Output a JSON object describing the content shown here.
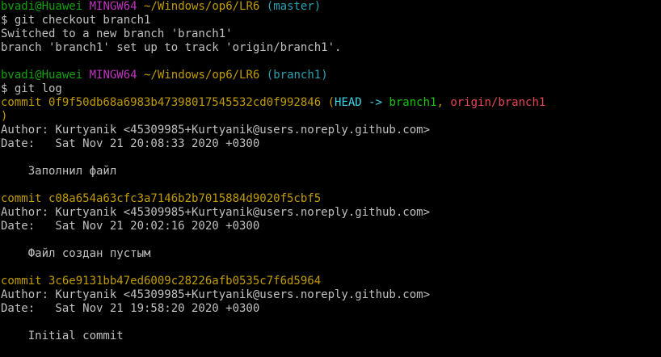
{
  "colors": {
    "background": "#000000",
    "default_text": "#c0c0c0",
    "user_host": "#13a10e",
    "mingw": "#c034c0",
    "path": "#c19c00",
    "branch_paren": "#2aa1b3",
    "head": "#3bd6e6",
    "local_branch": "#16c60c",
    "remote_branch": "#e74856"
  },
  "terminal": {
    "lines": [
      {
        "segments": [
          {
            "text": "bvadi@Huawei",
            "color": "green"
          },
          {
            "text": " ",
            "color": "gray"
          },
          {
            "text": "MINGW64",
            "color": "magenta"
          },
          {
            "text": " ",
            "color": "gray"
          },
          {
            "text": "~/Windows/op6/LR6",
            "color": "yellow"
          },
          {
            "text": " ",
            "color": "gray"
          },
          {
            "text": "(master)",
            "color": "cyan"
          }
        ]
      },
      {
        "segments": [
          {
            "text": "$ git checkout branch1",
            "color": "gray"
          }
        ]
      },
      {
        "segments": [
          {
            "text": "Switched to a new branch 'branch1'",
            "color": "gray"
          }
        ]
      },
      {
        "segments": [
          {
            "text": "branch 'branch1' set up to track 'origin/branch1'.",
            "color": "gray"
          }
        ]
      },
      {
        "segments": [
          {
            "text": "",
            "color": "gray"
          }
        ]
      },
      {
        "segments": [
          {
            "text": "bvadi@Huawei",
            "color": "green"
          },
          {
            "text": " ",
            "color": "gray"
          },
          {
            "text": "MINGW64",
            "color": "magenta"
          },
          {
            "text": " ",
            "color": "gray"
          },
          {
            "text": "~/Windows/op6/LR6",
            "color": "yellow"
          },
          {
            "text": " ",
            "color": "gray"
          },
          {
            "text": "(branch1)",
            "color": "cyan"
          }
        ]
      },
      {
        "segments": [
          {
            "text": "$ git log",
            "color": "gray"
          }
        ]
      },
      {
        "segments": [
          {
            "text": "commit 0f9f50db68a6983b47398017545532cd0f992846 ",
            "color": "yellow"
          },
          {
            "text": "(",
            "color": "yellow"
          },
          {
            "text": "HEAD -> ",
            "color": "bcyan"
          },
          {
            "text": "branch1",
            "color": "bgreen"
          },
          {
            "text": ", ",
            "color": "yellow"
          },
          {
            "text": "origin/branch1",
            "color": "bred"
          }
        ]
      },
      {
        "segments": [
          {
            "text": ")",
            "color": "yellow"
          }
        ]
      },
      {
        "segments": [
          {
            "text": "Author: Kurtyanik <45309985+Kurtyanik@users.noreply.github.com>",
            "color": "gray"
          }
        ]
      },
      {
        "segments": [
          {
            "text": "Date:   Sat Nov 21 20:08:33 2020 +0300",
            "color": "gray"
          }
        ]
      },
      {
        "segments": [
          {
            "text": "",
            "color": "gray"
          }
        ]
      },
      {
        "segments": [
          {
            "text": "    Заполнил файл",
            "color": "gray"
          }
        ]
      },
      {
        "segments": [
          {
            "text": "",
            "color": "gray"
          }
        ]
      },
      {
        "segments": [
          {
            "text": "commit c08a654a63cfc3a7146b2b7015884d9020f5cbf5",
            "color": "yellow"
          }
        ]
      },
      {
        "segments": [
          {
            "text": "Author: Kurtyanik <45309985+Kurtyanik@users.noreply.github.com>",
            "color": "gray"
          }
        ]
      },
      {
        "segments": [
          {
            "text": "Date:   Sat Nov 21 20:02:16 2020 +0300",
            "color": "gray"
          }
        ]
      },
      {
        "segments": [
          {
            "text": "",
            "color": "gray"
          }
        ]
      },
      {
        "segments": [
          {
            "text": "    Файл создан пустым",
            "color": "gray"
          }
        ]
      },
      {
        "segments": [
          {
            "text": "",
            "color": "gray"
          }
        ]
      },
      {
        "segments": [
          {
            "text": "commit 3c6e9131bb47ed6009c28226afb0535c7f6d5964",
            "color": "yellow"
          }
        ]
      },
      {
        "segments": [
          {
            "text": "Author: Kurtyanik <45309985+Kurtyanik@users.noreply.github.com>",
            "color": "gray"
          }
        ]
      },
      {
        "segments": [
          {
            "text": "Date:   Sat Nov 21 19:58:20 2020 +0300",
            "color": "gray"
          }
        ]
      },
      {
        "segments": [
          {
            "text": "",
            "color": "gray"
          }
        ]
      },
      {
        "segments": [
          {
            "text": "    Initial commit",
            "color": "gray"
          }
        ]
      }
    ]
  }
}
